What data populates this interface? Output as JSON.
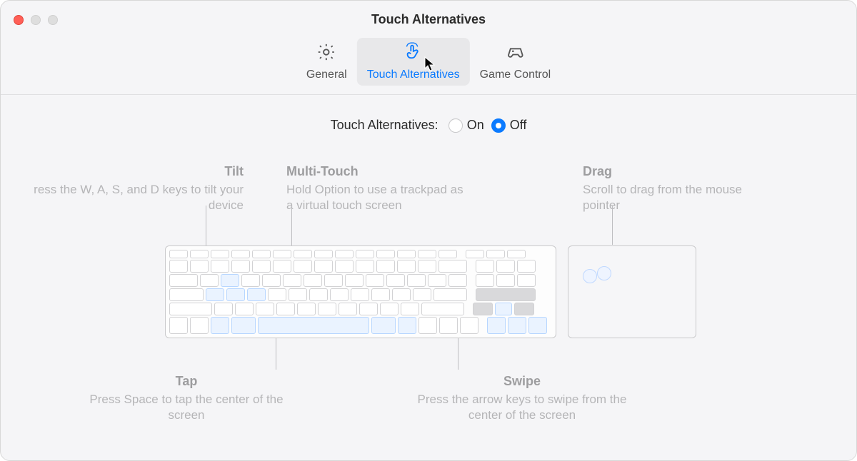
{
  "window": {
    "title": "Touch Alternatives"
  },
  "tabs": {
    "general": "General",
    "touch": "Touch Alternatives",
    "game": "Game Control"
  },
  "toggle": {
    "label": "Touch Alternatives:",
    "on": "On",
    "off": "Off",
    "selected": "off"
  },
  "sections": {
    "tilt": {
      "title": "Tilt",
      "body": "ress the W, A, S, and D keys to tilt your device"
    },
    "multi": {
      "title": "Multi-Touch",
      "body": "Hold Option to use a trackpad as a virtual touch screen"
    },
    "drag": {
      "title": "Drag",
      "body": "Scroll to drag from the mouse pointer"
    },
    "tap": {
      "title": "Tap",
      "body": "Press Space to tap the center of the screen"
    },
    "swipe": {
      "title": "Swipe",
      "body": "Press the arrow keys to swipe from the center of the screen"
    }
  }
}
